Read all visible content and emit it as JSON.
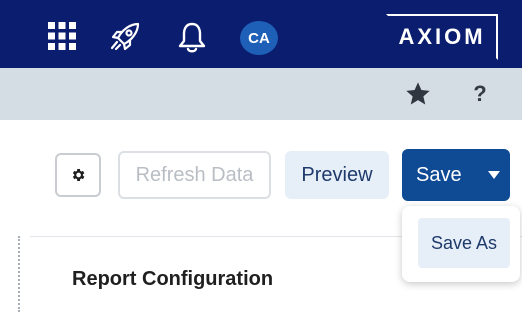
{
  "header": {
    "avatar_initials": "CA",
    "logo_text": "AXIOM",
    "icons": [
      "apps-grid-icon",
      "rocket-icon",
      "bell-icon"
    ],
    "background_color": "#0b1d6e"
  },
  "subheader": {
    "icons": [
      "star-icon",
      "help-icon"
    ],
    "help_label": "?"
  },
  "toolbar": {
    "settings_icon": "gear-icon",
    "refresh_label": "Refresh Data",
    "preview_label": "Preview",
    "save_label": "Save",
    "save_color": "#0e4b94"
  },
  "save_menu": {
    "items": [
      {
        "label": "Save As"
      }
    ]
  },
  "main": {
    "section_title": "Report Configuration"
  }
}
